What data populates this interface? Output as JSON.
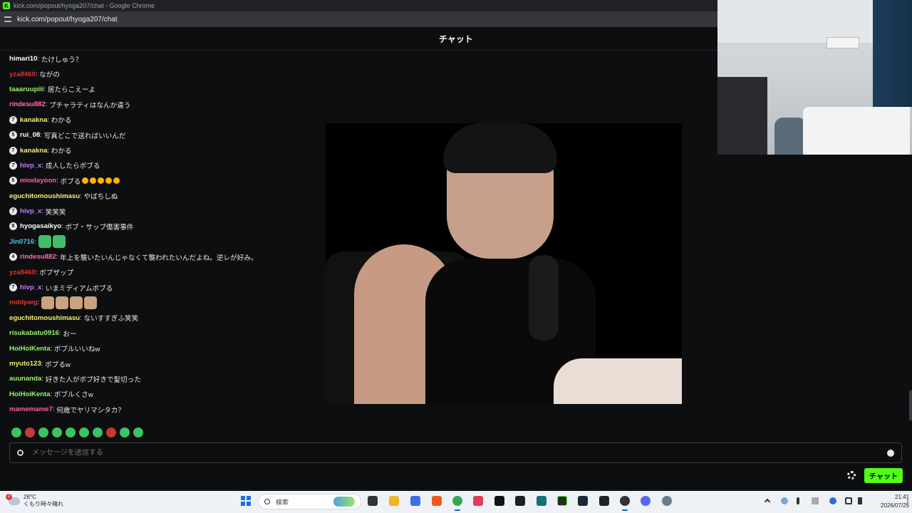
{
  "browser": {
    "title": "kick.com/popout/hyoga207/chat - Google Chrome",
    "url": "kick.com/popout/hyoga207/chat"
  },
  "chat": {
    "header": "チャット",
    "messages": [
      {
        "badge": "",
        "user": "himari10",
        "color": "#ffffff",
        "text": "たけしゅう？"
      },
      {
        "badge": "",
        "user": "yza8460",
        "color": "#e0342c",
        "text": "ながの"
      },
      {
        "badge": "",
        "user": "taaaruupiii",
        "color": "#9ef36b",
        "text": "居たらこえーよ"
      },
      {
        "badge": "",
        "user": "rindesu882",
        "color": "#ff6fb0",
        "text": "プチャラティはなんか違う"
      },
      {
        "badge": "7",
        "user": "kanakna",
        "color": "#f4f07a",
        "text": "わかる"
      },
      {
        "badge": "5",
        "user": "rui_08",
        "color": "#ffffff",
        "text": "写真どこで送ればいいんだ"
      },
      {
        "badge": "7",
        "user": "kanakna",
        "color": "#f4f07a",
        "text": "わかる"
      },
      {
        "badge": "7",
        "user": "hivp_x",
        "color": "#c77dff",
        "text": "成人したらボブる"
      },
      {
        "badge": "6",
        "user": "miodayoon",
        "color": "#ff5fa2",
        "text": "ボブる",
        "emotes": 5
      },
      {
        "badge": "",
        "user": "eguchitomoushimasu",
        "color": "#f4f07a",
        "text": "やばちしぬ"
      },
      {
        "badge": "7",
        "user": "hivp_x",
        "color": "#c77dff",
        "text": "笑笑笑"
      },
      {
        "badge": "8",
        "user": "hyogasaikyo",
        "color": "#ffffff",
        "text": "ボブ・サップ傷害事件"
      },
      {
        "badge": "",
        "user": "Jin0716",
        "color": "#4fc3f7",
        "text": "",
        "big_emotes": 2,
        "emote_color": "green"
      },
      {
        "badge": "4",
        "user": "rindesu882",
        "color": "#ff6fb0",
        "text": "年上を襲いたいんじゃなくて襲われたいんだよね。逆レが好み。"
      },
      {
        "badge": "",
        "user": "yza8460",
        "color": "#e0342c",
        "text": "ボブザップ"
      },
      {
        "badge": "7",
        "user": "hivp_x",
        "color": "#c77dff",
        "text": "いまミディアムボブる"
      },
      {
        "badge": "",
        "user": "mddpwg",
        "color": "#e0342c",
        "text": "",
        "big_emotes": 4,
        "emote_color": "tan"
      },
      {
        "badge": "",
        "user": "eguchitomoushimasu",
        "color": "#f4f07a",
        "text": "ないすすぎふ笑笑"
      },
      {
        "badge": "",
        "user": "risukabatu0916",
        "color": "#9ef36b",
        "text": "おー"
      },
      {
        "badge": "",
        "user": "HoiHoiKenta",
        "color": "#9ef36b",
        "text": "ボブルいいねw"
      },
      {
        "badge": "",
        "user": "myuto123",
        "color": "#f4f07a",
        "text": "ボブるw"
      },
      {
        "badge": "",
        "user": "auunanda",
        "color": "#9ef36b",
        "text": "好きた人がボブ好きで髪切った"
      },
      {
        "badge": "",
        "user": "HoiHoiKenta",
        "color": "#9ef36b",
        "text": "ボブルくさw"
      },
      {
        "badge": "",
        "user": "mamemame7",
        "color": "#ff5fa2",
        "text": "何歳でヤリマシタカ？"
      }
    ],
    "input_placeholder": "メッセージを送信する",
    "send_label": "チャット"
  },
  "taskbar": {
    "weather_temp": "28°C",
    "weather_text": "くもり時々晴れ",
    "weather_badge": "2",
    "search_placeholder": "検索",
    "time": "21:41",
    "date": "2026/07/25"
  },
  "colors": {
    "accent": "#53fc18",
    "background": "#0d0e10"
  }
}
